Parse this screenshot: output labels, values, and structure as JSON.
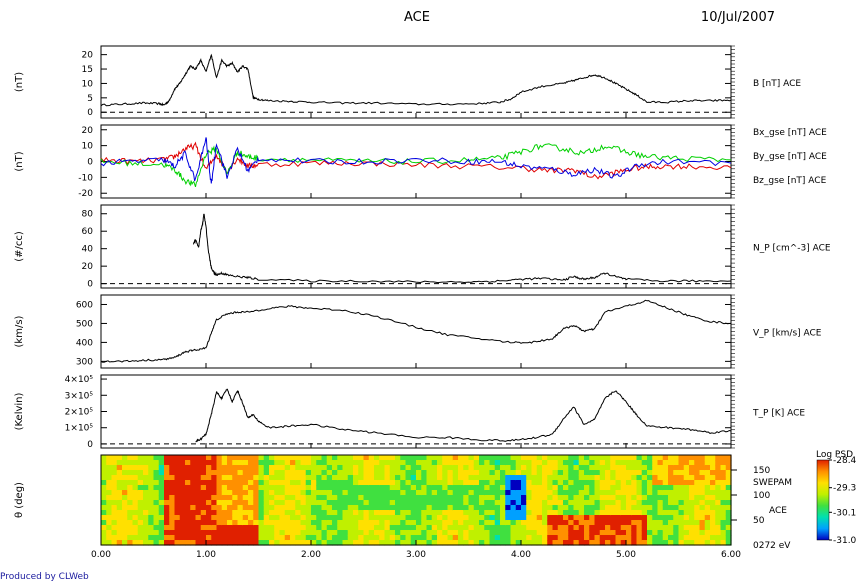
{
  "header": {
    "title": "ACE",
    "date": "10/Jul/2007"
  },
  "footer": {
    "credit": "Produced by CLWeb"
  },
  "chart_data": [
    {
      "type": "line",
      "ylabel": "(nT)",
      "ylim": [
        -2,
        23
      ],
      "yticks": [
        0,
        5,
        10,
        15,
        20
      ],
      "ytick_labels": [
        "0",
        "5",
        "10",
        "15",
        "20"
      ],
      "series": [
        {
          "name": "B [nT] ACE",
          "color": "#000000",
          "x": [
            0.0,
            0.2,
            0.4,
            0.55,
            0.6,
            0.65,
            0.7,
            0.75,
            0.8,
            0.85,
            0.9,
            0.95,
            1.0,
            1.05,
            1.1,
            1.15,
            1.2,
            1.25,
            1.3,
            1.35,
            1.4,
            1.45,
            1.5,
            1.6,
            1.8,
            2.0,
            2.3,
            2.6,
            3.0,
            3.3,
            3.6,
            3.8,
            3.9,
            4.0,
            4.2,
            4.4,
            4.5,
            4.6,
            4.7,
            4.8,
            4.9,
            5.0,
            5.1,
            5.2,
            5.4,
            5.6,
            5.8,
            6.0
          ],
          "y": [
            2.5,
            2.8,
            3.2,
            3.0,
            2.5,
            4,
            8,
            10,
            13,
            16,
            15,
            18,
            14,
            20,
            12,
            18,
            16,
            17,
            14,
            16,
            15,
            5,
            4.5,
            4,
            3.8,
            3.5,
            3.2,
            3.2,
            2.8,
            2.8,
            3.0,
            3.5,
            4.5,
            7,
            9,
            10,
            11,
            12,
            13,
            12,
            10,
            8,
            6,
            3.5,
            3.5,
            4,
            4,
            4.2
          ]
        },
        {
          "name": "reference",
          "color": "#000000",
          "dashed": true,
          "x": [
            0.0,
            6.0
          ],
          "y": [
            0,
            0
          ]
        }
      ]
    },
    {
      "type": "line",
      "ylabel": "(nT)",
      "ylim": [
        -23,
        23
      ],
      "yticks": [
        -20,
        -10,
        0,
        10,
        20
      ],
      "ytick_labels": [
        "-20",
        "-10",
        "0",
        "10",
        "20"
      ],
      "series": [
        {
          "name": "Bx_gse [nT] ACE",
          "color": "#e00000",
          "x": [
            0.0,
            0.3,
            0.6,
            0.7,
            0.8,
            0.9,
            1.0,
            1.1,
            1.2,
            1.3,
            1.4,
            1.5,
            2.0,
            2.5,
            3.0,
            3.5,
            4.0,
            4.3,
            4.5,
            4.7,
            4.9,
            5.1,
            5.3,
            5.6,
            6.0
          ],
          "y": [
            1,
            0,
            1,
            3,
            8,
            10,
            -5,
            4,
            -6,
            2,
            -3,
            -2,
            -1,
            -1,
            -2,
            -3,
            -4,
            -6,
            -5,
            -10,
            -7,
            -4,
            -3,
            -3,
            -4
          ]
        },
        {
          "name": "By_gse [nT] ACE",
          "color": "#00d000",
          "x": [
            0.0,
            0.3,
            0.6,
            0.7,
            0.8,
            0.9,
            1.0,
            1.1,
            1.2,
            1.3,
            1.4,
            1.5,
            2.0,
            2.5,
            3.0,
            3.5,
            3.8,
            4.0,
            4.2,
            4.4,
            4.6,
            4.8,
            5.0,
            5.2,
            5.5,
            6.0
          ],
          "y": [
            0,
            -1,
            -2,
            -5,
            -12,
            -15,
            5,
            8,
            -8,
            6,
            3,
            2,
            1,
            0,
            0,
            1,
            2,
            6,
            10,
            8,
            5,
            10,
            6,
            3,
            2,
            1
          ]
        },
        {
          "name": "Bz_gse [nT] ACE",
          "color": "#0000e0",
          "x": [
            0.0,
            0.3,
            0.6,
            0.7,
            0.8,
            0.9,
            1.0,
            1.05,
            1.1,
            1.2,
            1.3,
            1.4,
            1.5,
            2.0,
            2.5,
            3.0,
            3.5,
            3.8,
            4.0,
            4.3,
            4.5,
            4.7,
            4.9,
            5.1,
            5.4,
            6.0
          ],
          "y": [
            -1,
            0,
            1,
            -3,
            5,
            -12,
            15,
            -15,
            12,
            -10,
            8,
            -6,
            2,
            0,
            0,
            1,
            0,
            0,
            -3,
            -5,
            -8,
            -5,
            -10,
            -2,
            0,
            -1
          ]
        }
      ]
    },
    {
      "type": "line",
      "ylabel": "(#/cc)",
      "ylim": [
        -5,
        90
      ],
      "yticks": [
        0,
        20,
        40,
        60,
        80
      ],
      "ytick_labels": [
        "0",
        "20",
        "40",
        "60",
        "80"
      ],
      "series": [
        {
          "name": "N_P [cm^-3] ACE",
          "color": "#000000",
          "x": [
            0.88,
            0.9,
            0.93,
            0.95,
            0.97,
            0.98,
            1.0,
            1.02,
            1.05,
            1.08,
            1.1,
            1.15,
            1.2,
            1.3,
            1.4,
            1.5,
            2.0,
            2.5,
            3.0,
            3.5,
            3.8,
            4.0,
            4.2,
            4.4,
            4.5,
            4.6,
            4.7,
            4.8,
            4.9,
            5.0,
            5.3,
            5.6,
            6.0
          ],
          "y": [
            45,
            50,
            42,
            60,
            70,
            80,
            65,
            40,
            18,
            12,
            10,
            12,
            10,
            8,
            7,
            5,
            3,
            3,
            2,
            2,
            3,
            5,
            6,
            4,
            8,
            5,
            7,
            12,
            8,
            5,
            3,
            3,
            3
          ]
        },
        {
          "name": "reference",
          "color": "#000000",
          "dashed": true,
          "x": [
            0.0,
            6.0
          ],
          "y": [
            0,
            0
          ]
        }
      ]
    },
    {
      "type": "line",
      "ylabel": "(km/s)",
      "ylim": [
        265,
        650
      ],
      "yticks": [
        300,
        400,
        500,
        600
      ],
      "ytick_labels": [
        "300",
        "400",
        "500",
        "600"
      ],
      "series": [
        {
          "name": "V_P [km/s] ACE",
          "color": "#000000",
          "x": [
            0.0,
            0.2,
            0.4,
            0.6,
            0.7,
            0.8,
            0.9,
            1.0,
            1.05,
            1.1,
            1.2,
            1.3,
            1.4,
            1.6,
            1.8,
            2.0,
            2.3,
            2.6,
            3.0,
            3.3,
            3.6,
            3.9,
            4.1,
            4.3,
            4.4,
            4.5,
            4.6,
            4.7,
            4.8,
            5.0,
            5.2,
            5.4,
            5.6,
            5.8,
            6.0
          ],
          "y": [
            300,
            300,
            305,
            310,
            320,
            350,
            360,
            370,
            450,
            520,
            550,
            560,
            560,
            580,
            590,
            580,
            570,
            540,
            480,
            440,
            420,
            400,
            400,
            420,
            470,
            490,
            460,
            470,
            560,
            590,
            620,
            580,
            540,
            510,
            500
          ]
        }
      ]
    },
    {
      "type": "line",
      "ylabel": "(Kelvin)",
      "ylim": [
        -250000,
        4250000
      ],
      "yticks": [
        0,
        1000000,
        2000000,
        3000000,
        4000000
      ],
      "ytick_labels": [
        "0",
        "1×10⁵",
        "2×10⁵",
        "3×10⁵",
        "4×10⁵"
      ],
      "series": [
        {
          "name": "T_P [K] ACE",
          "color": "#000000",
          "x": [
            0.9,
            0.95,
            1.0,
            1.05,
            1.1,
            1.15,
            1.2,
            1.25,
            1.3,
            1.35,
            1.4,
            1.45,
            1.5,
            1.6,
            1.8,
            2.0,
            2.3,
            2.6,
            3.0,
            3.3,
            3.6,
            3.9,
            4.1,
            4.3,
            4.4,
            4.5,
            4.6,
            4.7,
            4.8,
            4.9,
            5.0,
            5.1,
            5.2,
            5.4,
            5.6,
            5.8,
            6.0
          ],
          "y": [
            150000,
            300000,
            600000,
            1800000,
            3200000,
            2800000,
            3400000,
            2600000,
            3300000,
            2500000,
            1600000,
            1800000,
            1400000,
            1000000,
            1100000,
            1200000,
            900000,
            700000,
            400000,
            400000,
            250000,
            200000,
            350000,
            600000,
            1500000,
            2300000,
            1200000,
            1500000,
            2800000,
            3300000,
            2600000,
            1800000,
            1100000,
            1000000,
            900000,
            700000,
            800000
          ]
        },
        {
          "name": "reference",
          "color": "#000000",
          "dashed": true,
          "x": [
            0.0,
            6.0
          ],
          "y": [
            0,
            0
          ]
        }
      ]
    },
    {
      "type": "heatmap",
      "ylabel": "θ (deg)",
      "ylim": [
        0,
        180
      ],
      "yticks": [
        50,
        100,
        150
      ],
      "ytick_labels": [
        "50",
        "100",
        "150"
      ],
      "right_labels": {
        "instrument": "SWEPAM",
        "spacecraft": "ACE",
        "energy": "0272 eV"
      },
      "colorbar": {
        "title": "Log PSD",
        "ticks": [
          "-28.4",
          "-29.3",
          "-30.1",
          "-31.0"
        ],
        "range": [
          -31.0,
          -28.4
        ]
      },
      "colors": [
        "#0000c0",
        "#00a0ff",
        "#00e0b0",
        "#40e040",
        "#c0f000",
        "#ffe000",
        "#ff9000",
        "#e02000"
      ]
    }
  ],
  "x_axis": {
    "xlim": [
      0,
      6
    ],
    "tick_labels": [
      "0.00",
      "1.00",
      "2.00",
      "3.00",
      "4.00",
      "5.00",
      "6.00"
    ]
  }
}
